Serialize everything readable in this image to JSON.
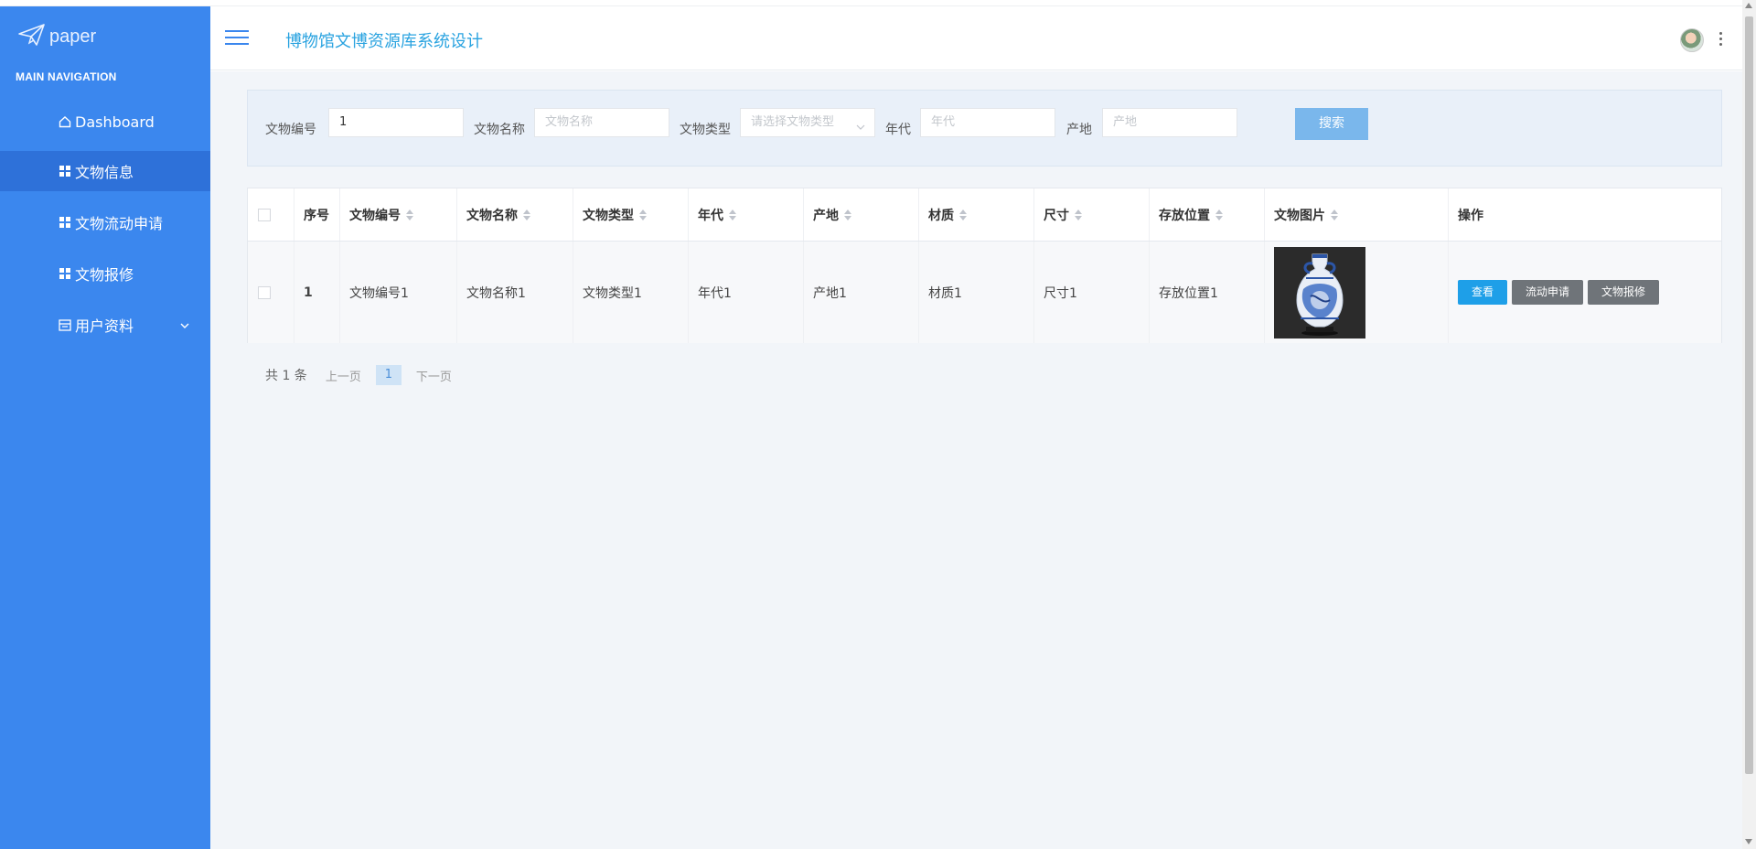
{
  "brand": {
    "logo_text": "paper",
    "logo_icon": "paper-plane-icon"
  },
  "app": {
    "title": "博物馆文博资源库系统设计"
  },
  "sidebar": {
    "caption": "MAIN NAVIGATION",
    "items": [
      {
        "label": "Dashboard",
        "icon": "home-icon"
      },
      {
        "label": "文物信息",
        "icon": "grid-icon",
        "active": true
      },
      {
        "label": "文物流动申请",
        "icon": "grid-icon"
      },
      {
        "label": "文物报修",
        "icon": "grid-icon"
      },
      {
        "label": "用户资料",
        "icon": "calendar-icon",
        "expandable": true
      }
    ]
  },
  "search": {
    "fields": [
      {
        "label": "文物编号",
        "value": "1",
        "placeholder": ""
      },
      {
        "label": "文物名称",
        "value": "",
        "placeholder": "文物名称"
      },
      {
        "label": "文物类型",
        "value": "",
        "placeholder": "请选择文物类型"
      },
      {
        "label": "年代",
        "value": "",
        "placeholder": "年代"
      },
      {
        "label": "产地",
        "value": "",
        "placeholder": "产地"
      }
    ],
    "button_label": "搜索"
  },
  "table": {
    "headers": [
      "序号",
      "文物编号",
      "文物名称",
      "文物类型",
      "年代",
      "产地",
      "材质",
      "尺寸",
      "存放位置",
      "文物图片",
      "操作"
    ],
    "rows": [
      {
        "index": "1",
        "code": "文物编号1",
        "name": "文物名称1",
        "type": "文物类型1",
        "era": "年代1",
        "origin": "产地1",
        "material": "材质1",
        "size": "尺寸1",
        "location": "存放位置1",
        "image": "blue-white-porcelain-vase",
        "actions": [
          "查看",
          "流动申请",
          "文物报修"
        ]
      }
    ]
  },
  "pagination": {
    "total_text": "共 1 条",
    "prev": "上一页",
    "current": "1",
    "next": "下一页"
  },
  "colors": {
    "sidebar": "#3b87ee",
    "active_item": "#2e71d9",
    "title": "#2aa3e0",
    "view_button": "#1e9fe8",
    "gray_button": "#6f7479",
    "search_button": "#7ab7ec"
  }
}
